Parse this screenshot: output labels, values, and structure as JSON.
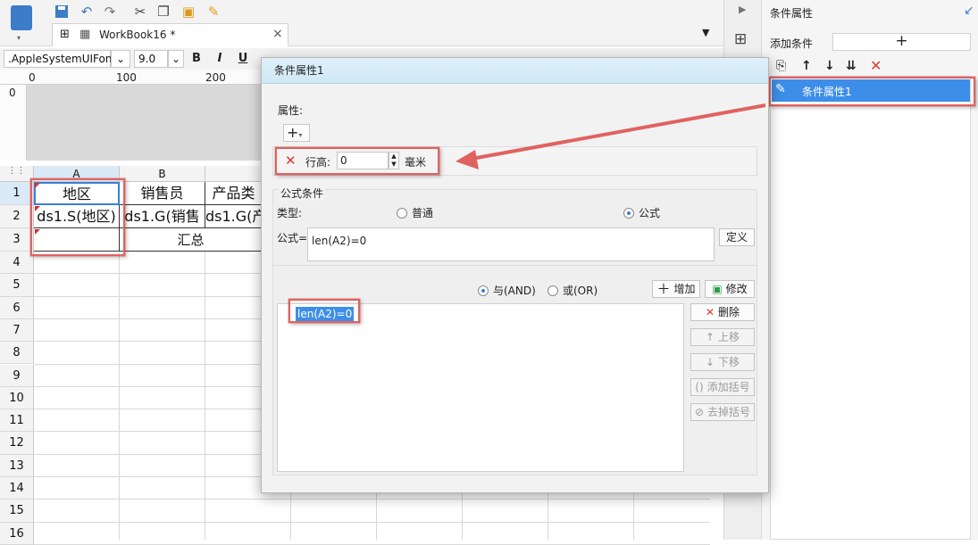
{
  "toolbar": {
    "icons": [
      "app-menu-icon",
      "save-icon",
      "undo-icon",
      "redo-icon",
      "cut-icon",
      "copy-icon",
      "paste-icon",
      "format-painter-icon"
    ]
  },
  "tab": {
    "title": "WorkBook16 *",
    "close": "×"
  },
  "format": {
    "font": ".AppleSystemUIFont",
    "size": "9.0",
    "bold": "B",
    "italic": "I",
    "underline": "U"
  },
  "ruler": {
    "marks": [
      "0",
      "100",
      "200"
    ],
    "vmark": "0"
  },
  "sheet": {
    "columns": [
      "A",
      "B",
      "C"
    ],
    "rows": [
      "1",
      "2",
      "3",
      "4",
      "5",
      "6",
      "7",
      "8",
      "9",
      "10",
      "11",
      "12",
      "13",
      "14",
      "15",
      "16"
    ],
    "cells": {
      "a1": "地区",
      "b1": "销售员",
      "c1": "产品类",
      "a2": "ds1.S(地区)",
      "b2": "ds1.G(销售",
      "c2": "ds1.G(产",
      "b3": "汇总"
    }
  },
  "right_panel": {
    "title": "条件属性",
    "add_label": "添加条件",
    "add_button": "+",
    "list": [
      "条件属性1"
    ]
  },
  "dialog": {
    "title": "条件属性1",
    "attr_label": "属性:",
    "add_attr": "+",
    "row_height_label": "行高:",
    "row_height_value": "0",
    "unit": "毫米",
    "formula_section": "公式条件",
    "type_label": "类型:",
    "type_normal": "普通",
    "type_formula": "公式",
    "formula_label": "公式=",
    "formula_value": "len(A2)=0",
    "define_button": "定义",
    "and_label": "与(AND)",
    "or_label": "或(OR)",
    "add_button": "增加",
    "modify_button": "修改",
    "condition_item": "len(A2)=0",
    "delete_button": "删除",
    "up_button": "上移",
    "down_button": "下移",
    "add_paren_button": "添加括号",
    "remove_paren_button": "去掉括号"
  },
  "colors": {
    "accent": "#3b8eea",
    "annotation": "#e06260",
    "selection": "#3d8ee9"
  }
}
